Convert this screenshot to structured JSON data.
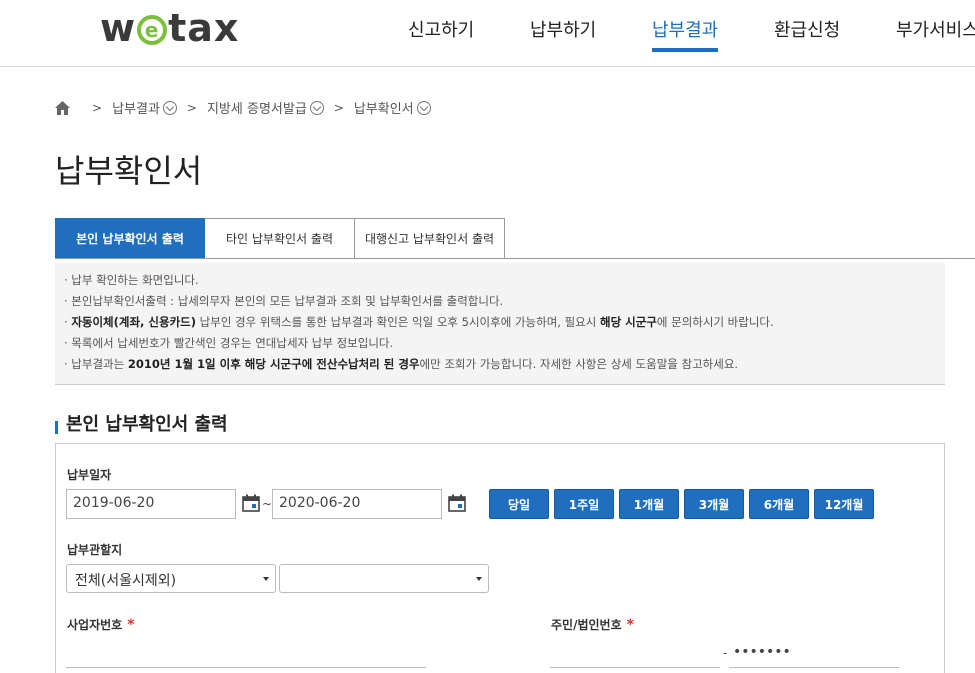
{
  "logo": {
    "pre": "w",
    "mid": "e",
    "post": "tax",
    "accent": "#7cbf3a"
  },
  "gnb": [
    {
      "label": "신고하기"
    },
    {
      "label": "납부하기"
    },
    {
      "label": "납부결과"
    },
    {
      "label": "환급신청"
    },
    {
      "label": "부가서비스"
    }
  ],
  "breadcrumb": {
    "home_icon": "home-icon",
    "items": [
      "납부결과",
      "지방세 증명서발급",
      "납부확인서"
    ]
  },
  "page_title": "납부확인서",
  "tabs": [
    {
      "label": "본인 납부확인서 출력"
    },
    {
      "label": "타인 납부확인서 출력"
    },
    {
      "label": "대행신고 납부확인서 출력"
    }
  ],
  "notice": {
    "line1": "· 납부 확인하는 화면입니다.",
    "line2": "· 본인납부확인서출력 : 납세의무자 본인의 모든 납부결과 조회 및 납부확인서를 출력합니다.",
    "line3_pre": "· ",
    "line3_bold1": "자동이체(계좌, 신용카드)",
    "line3_mid": " 납부인 경우 위택스를 통한 납부결과 확인은 익일 오후 5시이후에 가능하며, 필요시 ",
    "line3_bold2": "해당 시군구",
    "line3_post": "에 문의하시기 바랍니다.",
    "line4": "· 목록에서 납세번호가 빨간색인 경우는 연대납세자 납부 정보입니다.",
    "line5_pre": "· 납부결과는 ",
    "line5_bold": "2010년 1월 1일 이후 해당 시군구에 전산수납처리 된 경우",
    "line5_post": "에만 조회가 가능합니다. 자세한 사항은 상세 도움말을 참고하세요."
  },
  "section_title": "본인 납부확인서 출력",
  "form": {
    "pay_date_label": "납부일자",
    "date_from": "2019-06-20",
    "date_to": "2020-06-20",
    "tilde": "~",
    "period_buttons": [
      "당일",
      "1주일",
      "1개월",
      "3개월",
      "6개월",
      "12개월"
    ],
    "region_label": "납부관할지",
    "region_select1": "전체(서울시제외)",
    "region_select2": "",
    "biz_no_label": "사업자번호",
    "biz_no_value": "",
    "jumin_label": "주민/법인번호",
    "jumin_front": "",
    "jumin_dash": "-",
    "jumin_back": "•••••••",
    "required_mark": "*"
  },
  "colors": {
    "primary": "#1f6fbe",
    "required": "#e03030"
  }
}
